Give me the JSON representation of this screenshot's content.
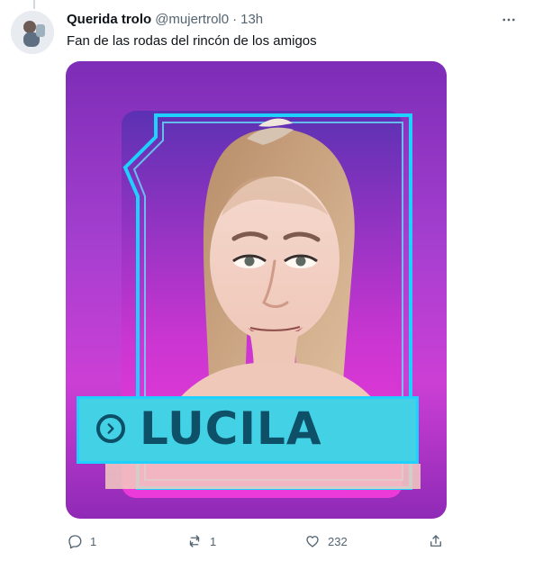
{
  "tweet": {
    "author_name": "Querida trolo",
    "author_handle": "@mujertrol0",
    "separator": "·",
    "time": "13h",
    "text": "Fan de las rodas del rincón de los amigos",
    "media": {
      "label": "LUCILA"
    },
    "actions": {
      "reply_count": "1",
      "retweet_count": "1",
      "like_count": "232"
    }
  },
  "icons": {
    "more": "more-icon",
    "reply": "reply-icon",
    "retweet": "retweet-icon",
    "like": "like-icon",
    "share": "share-icon",
    "chevron": "chevron-right-icon"
  },
  "colors": {
    "text_primary": "#0f1419",
    "text_secondary": "#536471",
    "media_purple": "#a53fd0",
    "frame_blue": "#1fd1ff",
    "label_color": "#0e5067"
  }
}
